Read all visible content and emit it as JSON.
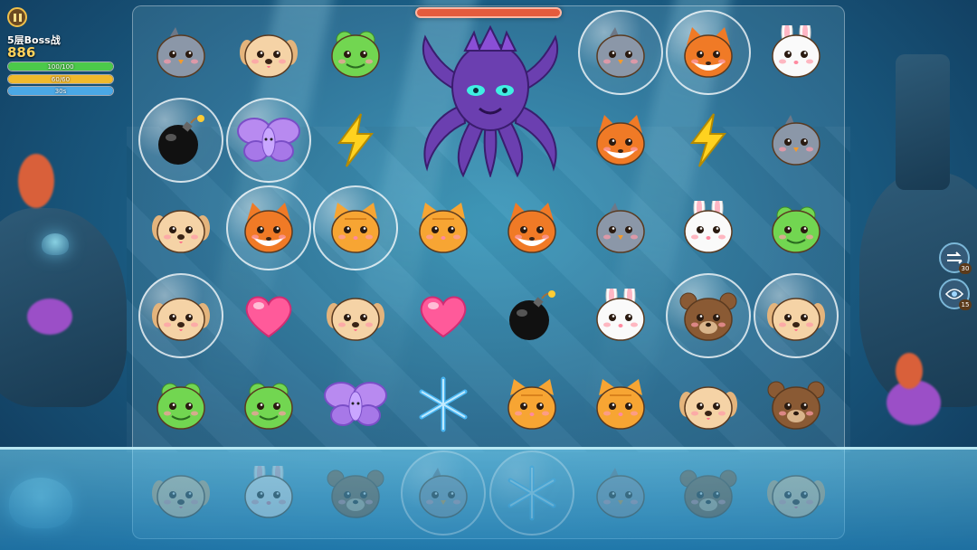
{
  "hud": {
    "level": "5层Boss战",
    "score": "886",
    "health": {
      "label": "100/100",
      "value": 100,
      "max": 100,
      "color": "#4cc94a"
    },
    "energy": {
      "label": "60/60",
      "value": 60,
      "max": 60,
      "color": "#f0b92c"
    },
    "timer": {
      "label": "30s",
      "fraction": 1.0,
      "color": "#4aa8e6"
    }
  },
  "boss": {
    "name": "octopus",
    "health_fraction": 1.0
  },
  "tools": [
    {
      "icon": "swap-arrows-icon",
      "count": "30"
    },
    {
      "icon": "eye-icon",
      "count": "15"
    }
  ],
  "grid": {
    "rows": [
      [
        {
          "t": "chick"
        },
        {
          "t": "puppy"
        },
        {
          "t": "frog"
        },
        {
          "t": "boss"
        },
        {
          "t": "boss"
        },
        {
          "t": "boss"
        },
        {
          "t": "chick",
          "b": true
        },
        {
          "t": "fox",
          "b": true
        },
        {
          "t": "bunny"
        }
      ],
      [
        {
          "t": "bomb",
          "b": true
        },
        {
          "t": "butterfly",
          "b": true
        },
        {
          "t": "lightning"
        },
        {
          "t": "boss"
        },
        {
          "t": "boss"
        },
        {
          "t": "boss"
        },
        {
          "t": "fox"
        },
        {
          "t": "lightning"
        },
        {
          "t": "chick"
        }
      ],
      [
        {
          "t": "puppy"
        },
        {
          "t": "fox",
          "b": true
        },
        {
          "t": "cat",
          "b": true
        },
        {
          "t": "cat"
        },
        {
          "t": "fox"
        },
        {
          "t": "chick"
        },
        {
          "t": "bunny"
        },
        {
          "t": "frog"
        }
      ],
      [
        {
          "t": "puppy",
          "b": true
        },
        {
          "t": "heart"
        },
        {
          "t": "puppy"
        },
        {
          "t": "heart"
        },
        {
          "t": "bomb"
        },
        {
          "t": "bunny"
        },
        {
          "t": "bear",
          "b": true
        },
        {
          "t": "puppy",
          "b": true
        }
      ],
      [
        {
          "t": "frog"
        },
        {
          "t": "frog"
        },
        {
          "t": "butterfly"
        },
        {
          "t": "snowflake"
        },
        {
          "t": "cat"
        },
        {
          "t": "cat"
        },
        {
          "t": "puppy"
        },
        {
          "t": "bear"
        }
      ],
      [
        {
          "t": "puppy"
        },
        {
          "t": "bunny"
        },
        {
          "t": "bear"
        },
        {
          "t": "chick",
          "b": true
        },
        {
          "t": "snowflake",
          "b": true
        },
        {
          "t": "chick"
        },
        {
          "t": "bear"
        },
        {
          "t": "puppy"
        }
      ]
    ]
  }
}
